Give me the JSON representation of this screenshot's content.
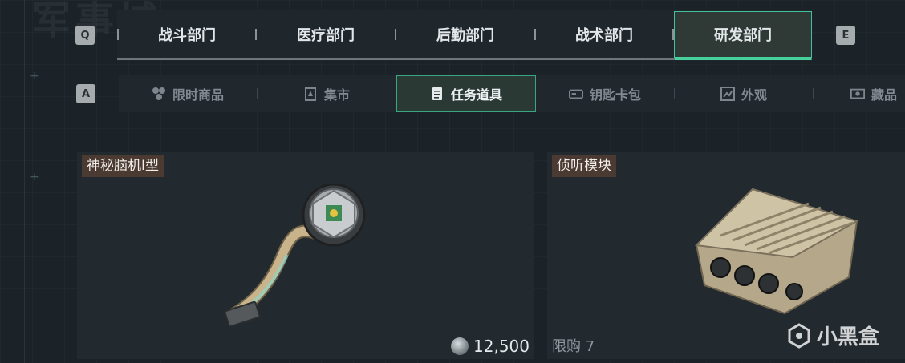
{
  "background_text": "军事城",
  "top_tabs": {
    "prev_key": "Q",
    "next_key": "E",
    "items": [
      {
        "label": "战斗部门"
      },
      {
        "label": "医疗部门"
      },
      {
        "label": "后勤部门"
      },
      {
        "label": "战术部门"
      },
      {
        "label": "研发部门",
        "active": true
      }
    ]
  },
  "sub_tabs": {
    "prev_key": "A",
    "items": [
      {
        "label": "限时商品",
        "icon": "radiation-icon"
      },
      {
        "label": "集市",
        "icon": "market-icon"
      },
      {
        "label": "任务道具",
        "icon": "document-icon",
        "active": true
      },
      {
        "label": "钥匙卡包",
        "icon": "keycard-icon"
      },
      {
        "label": "外观",
        "icon": "appearance-icon"
      },
      {
        "label": "藏品",
        "icon": "collection-icon"
      }
    ]
  },
  "items": [
    {
      "name": "神秘脑机Ⅰ型",
      "price": "12,500"
    },
    {
      "name": "侦听模块",
      "limit": "限购 7"
    }
  ],
  "watermark": "小黑盒",
  "colors": {
    "accent": "#46d19c",
    "background": "#1b2228",
    "title_tag": "#4a3a32"
  }
}
